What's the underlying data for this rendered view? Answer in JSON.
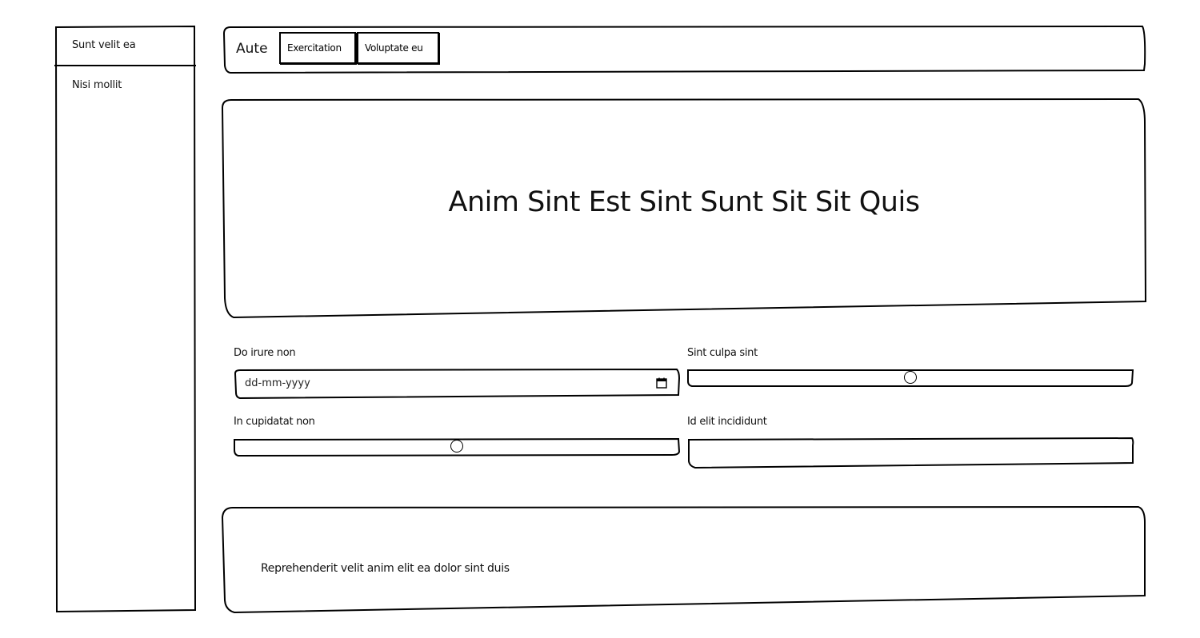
{
  "sidebar": {
    "items": [
      {
        "label": "Sunt velit ea"
      },
      {
        "label": "Nisi mollit"
      }
    ]
  },
  "topbar": {
    "brand": "Aute",
    "buttons": [
      {
        "label": "Exercitation"
      },
      {
        "label": "Voluptate eu"
      }
    ]
  },
  "hero": {
    "title": "Anim Sint Est Sint Sunt Sit Sit Quis"
  },
  "form": {
    "date_field": {
      "label": "Do irure non",
      "placeholder": "dd-mm-yyyy",
      "icon": "calendar-icon"
    },
    "slider_sint": {
      "label": "Sint culpa sint",
      "value_fraction": 0.5
    },
    "slider_in": {
      "label": "In cupidatat non",
      "value_fraction": 0.5
    },
    "text_field": {
      "label": "Id elit incididunt",
      "value": ""
    }
  },
  "footer": {
    "text": "Reprehenderit velit anim elit ea dolor sint duis"
  }
}
